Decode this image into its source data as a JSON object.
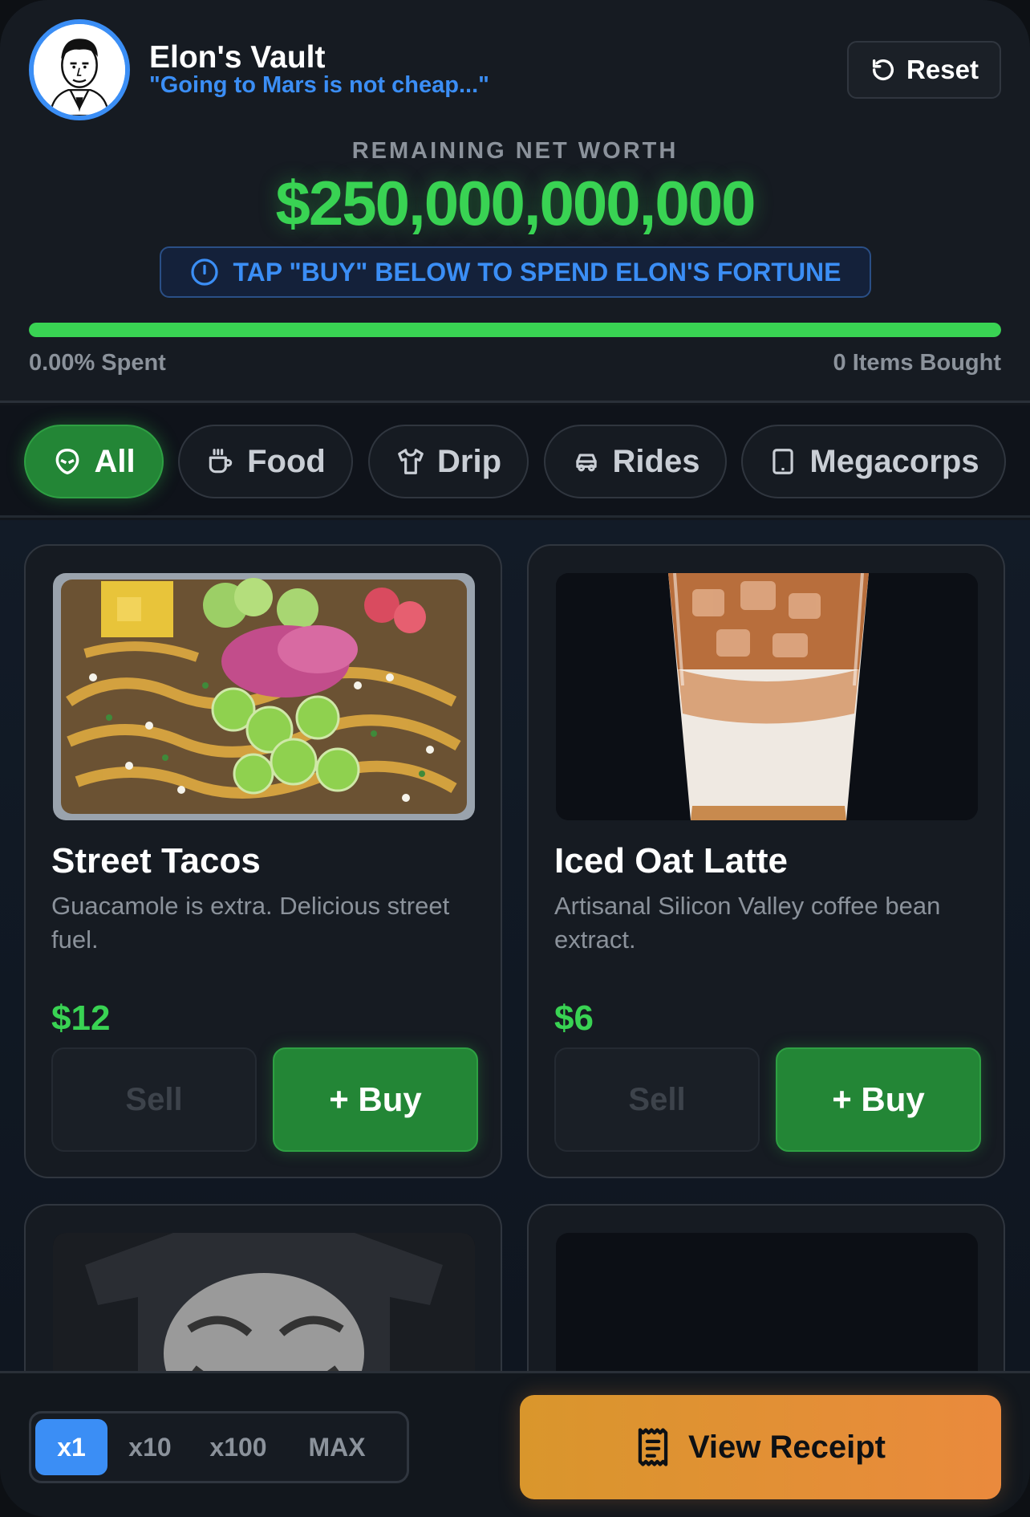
{
  "header": {
    "title": "Elon's Vault",
    "quote": "\"Going to Mars is not cheap...\"",
    "reset_label": "Reset",
    "net_worth_label": "REMAINING NET WORTH",
    "net_worth_value": "$250,000,000,000",
    "tap_hint": "TAP \"BUY\" BELOW TO SPEND ELON'S FORTUNE",
    "progress_remaining_fraction": 1.0,
    "spent_text": "0.00% Spent",
    "items_text": "0 Items Bought",
    "accent_color": "#3b8ef5",
    "money_color": "#39d353"
  },
  "tabs": [
    {
      "label": "All",
      "icon": "alien-icon",
      "active": true
    },
    {
      "label": "Food",
      "icon": "coffee-cup-icon",
      "active": false
    },
    {
      "label": "Drip",
      "icon": "tshirt-icon",
      "active": false
    },
    {
      "label": "Rides",
      "icon": "car-icon",
      "active": false
    },
    {
      "label": "Megacorps",
      "icon": "tablet-icon",
      "active": false
    }
  ],
  "products": [
    {
      "name": "Street Tacos",
      "description": "Guacamole is extra. Delicious street fuel.",
      "price": "$12",
      "sell_label": "Sell",
      "buy_label": "+ Buy",
      "image": "street-tacos-image"
    },
    {
      "name": "Iced Oat Latte",
      "description": "Artisanal Silicon Valley coffee bean extract.",
      "price": "$6",
      "sell_label": "Sell",
      "buy_label": "+ Buy",
      "image": "iced-latte-image"
    },
    {
      "image": "troll-face-tshirt-image"
    },
    {
      "image": "product-image-placeholder"
    }
  ],
  "bottom": {
    "multipliers": [
      {
        "label": "x1",
        "active": true
      },
      {
        "label": "x10",
        "active": false
      },
      {
        "label": "x100",
        "active": false
      },
      {
        "label": "MAX",
        "active": false
      }
    ],
    "receipt_label": "View Receipt",
    "receipt_icon": "receipt-icon"
  }
}
